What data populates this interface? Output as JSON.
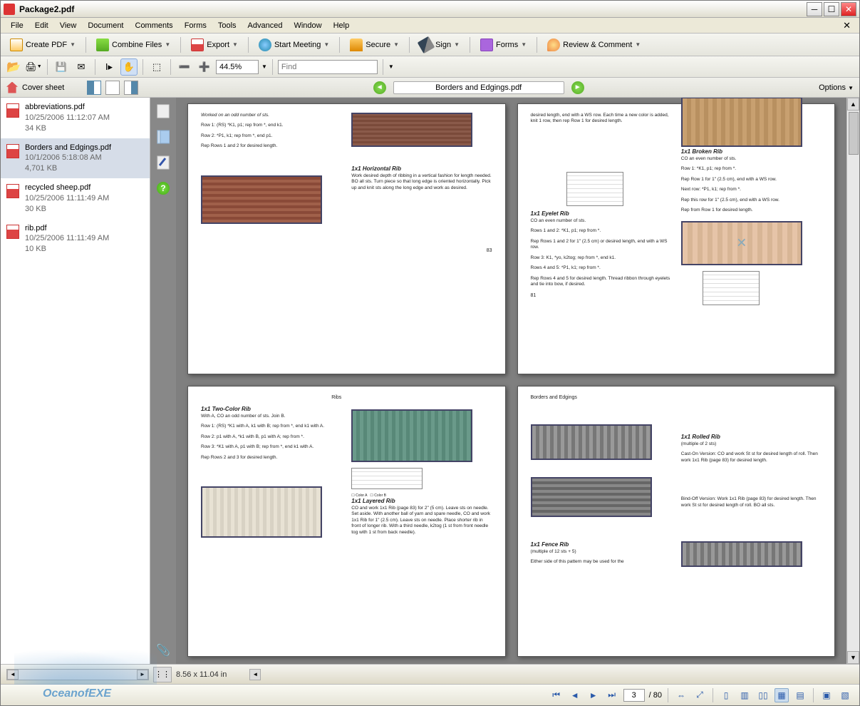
{
  "titlebar": {
    "title": "Package2.pdf"
  },
  "menubar": {
    "items": [
      "File",
      "Edit",
      "View",
      "Document",
      "Comments",
      "Forms",
      "Tools",
      "Advanced",
      "Window",
      "Help"
    ]
  },
  "toolbar1": {
    "create": "Create PDF",
    "combine": "Combine Files",
    "export": "Export",
    "meeting": "Start Meeting",
    "secure": "Secure",
    "sign": "Sign",
    "forms": "Forms",
    "review": "Review & Comment"
  },
  "toolbar2": {
    "zoom": "44.5%",
    "find": "Find"
  },
  "subbar": {
    "cover": "Cover sheet",
    "doctitle": "Borders and Edgings.pdf",
    "options": "Options"
  },
  "sidebar": {
    "files": [
      {
        "name": "abbreviations.pdf",
        "date": "10/25/2006 11:12:07 AM",
        "size": "34 KB"
      },
      {
        "name": "Borders and Edgings.pdf",
        "date": "10/1/2006 5:18:08 AM",
        "size": "4,701 KB"
      },
      {
        "name": "recycled sheep.pdf",
        "date": "10/25/2006 11:11:49 AM",
        "size": "30 KB"
      },
      {
        "name": "rib.pdf",
        "date": "10/25/2006 11:11:49 AM",
        "size": "10 KB"
      }
    ]
  },
  "pages": {
    "p1": {
      "intro1": "Worked on an odd number of sts.",
      "intro2": "Row 1: (RS) *K1, p1; rep from *, end k1.",
      "intro3": "Row 2: *P1, k1; rep from *, end p1.",
      "intro4": "Rep Rows 1 and 2 for desired length.",
      "h1": "1x1   Horizontal   Rib",
      "t1": "Work desired depth of ribbing in a vertical fashion for length needed. BO all sts. Turn piece so that long edge is oriented horizontally. Pick up and knit sts along the long edge and work as desired.",
      "pnum": "83"
    },
    "p2": {
      "top": "desired length, end with a WS row. Each time a new color is added, knit 1 row, then rep Row 1 for desired length.",
      "h1": "1x1   Broken   Rib",
      "t1a": "CO an even number of sts.",
      "t1b": "Row 1: *K1, p1; rep from *.",
      "t1c": "Rep Row 1 for 1\" (2.5 cm), end with a WS row.",
      "t1d": "Next row: *P1, k1; rep from *.",
      "t1e": "Rep this row for 1\" (2.5 cm), end with a WS row.",
      "t1f": "Rep from Row 1 for desired length.",
      "h2": "1x1   Eyelet   Rib",
      "t2a": "CO an even number of sts.",
      "t2b": "Rows 1 and 2: *K1, p1; rep from *.",
      "t2c": "Rep Rows 1 and 2 for 1\" (2.5 cm) or desired length, end with a WS row.",
      "t2d": "Row 3: K1, *yo, k2tog; rep from *, end k1.",
      "t2e": "Rows 4 and 5: *P1, k1; rep from *.",
      "t2f": "Rep Rows 4 and 5 for desired length. Thread ribbon through eyelets and tie into bow, if desired.",
      "pnum": "81"
    },
    "p3": {
      "corner": "Ribs",
      "h1": "1x1   Two-Color  Rib",
      "t1a": "With A, CO an odd number of sts. Join B.",
      "t1b": "Row 1: (RS) *K1 with A, k1 with B; rep from *, end k1 with A.",
      "t1c": "Row 2: p1 with A, *k1 with B, p1 with A; rep from *.",
      "t1d": "Row 3: *K1 with A, p1 with B; rep from *, end k1 with A.",
      "t1e": "Rep Rows 2 and 3 for desired length.",
      "h2": "1x1   Layered   Rib",
      "t2": "CO and work 1x1 Rib (page 83) for 2\" (5 cm). Leave sts on needle. Set aside. With another ball of yarn and spare needle, CO and work 1x1 Rib for 1\" (2.5 cm). Leave sts on needle. Place shorter rib in front of longer rib. With a third needle, k2tog (1 st from front needle tog with 1 st from back needle).",
      "legendA": "Color A",
      "legendB": "Color B"
    },
    "p4": {
      "corner": "Borders and Edgings",
      "h1": "1x1   Rolled   Rib",
      "sub1": "(multiple of 2 sts)",
      "t1": "Cast-On Version: CO and work St st for desired length of roll. Then work 1x1 Rib (page 83) for desired length.",
      "t2": "Bind-Off Version: Work 1x1 Rib (page 83) for desired length. Then work St st for desired length of roll. BO all sts.",
      "h2": "1x1   Fence   Rib",
      "sub2": "(multiple of 12 sts + 5)",
      "t3": "Either side of this pattern may be used for the"
    }
  },
  "status": {
    "dim": "8.56 x 11.04 in"
  },
  "nav": {
    "page": "3",
    "total": "/ 80"
  },
  "watermark": "OceanofEXE"
}
